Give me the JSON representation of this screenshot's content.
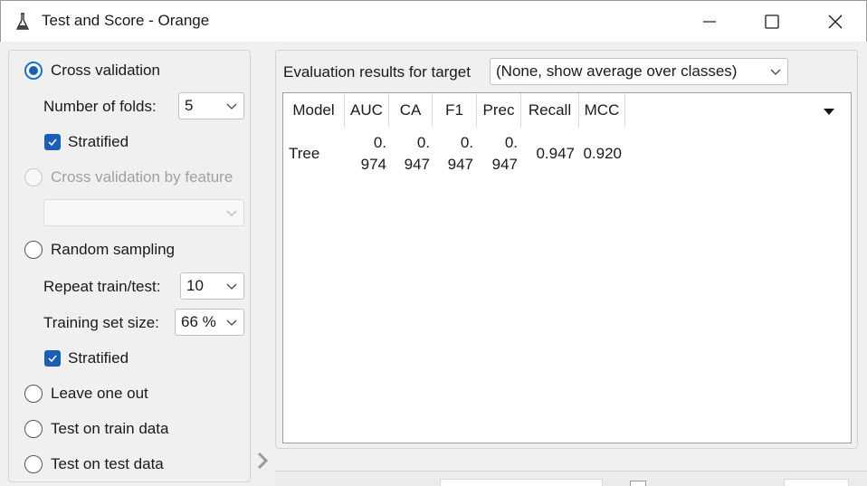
{
  "window": {
    "title": "Test and Score - Orange",
    "icon": "flask-icon"
  },
  "sampling": {
    "cross_validation": {
      "label": "Cross validation",
      "selected": true
    },
    "number_of_folds": {
      "label": "Number of folds:",
      "value": "5"
    },
    "stratified_cv": {
      "label": "Stratified",
      "checked": true
    },
    "cross_validation_by_feature": {
      "label": "Cross validation by feature",
      "enabled": false
    },
    "feature_select": {
      "value": ""
    },
    "random_sampling": {
      "label": "Random sampling",
      "selected": false
    },
    "repeat_train_test": {
      "label": "Repeat train/test:",
      "value": "10"
    },
    "training_set_size": {
      "label": "Training set size:",
      "value": "66 %"
    },
    "stratified_rs": {
      "label": "Stratified",
      "checked": true
    },
    "leave_one_out": {
      "label": "Leave one out",
      "selected": false
    },
    "test_on_train": {
      "label": "Test on train data",
      "selected": false
    },
    "test_on_test": {
      "label": "Test on test data",
      "selected": false
    }
  },
  "results": {
    "target_label": "Evaluation results for target",
    "target_value": "(None, show average over classes)",
    "columns": [
      "Model",
      "AUC",
      "CA",
      "F1",
      "Prec",
      "Recall",
      "MCC"
    ],
    "rows": [
      {
        "model": "Tree",
        "auc": [
          "0.",
          "974"
        ],
        "ca": [
          "0.",
          "947"
        ],
        "f1": [
          "0.",
          "947"
        ],
        "prec": [
          "0.",
          "947"
        ],
        "recall": "0.947",
        "mcc": "0.920"
      }
    ]
  },
  "colors": {
    "accent": "#1a5fb4",
    "panel_background": "#f0f0f0",
    "table_background": "#ffffff"
  }
}
